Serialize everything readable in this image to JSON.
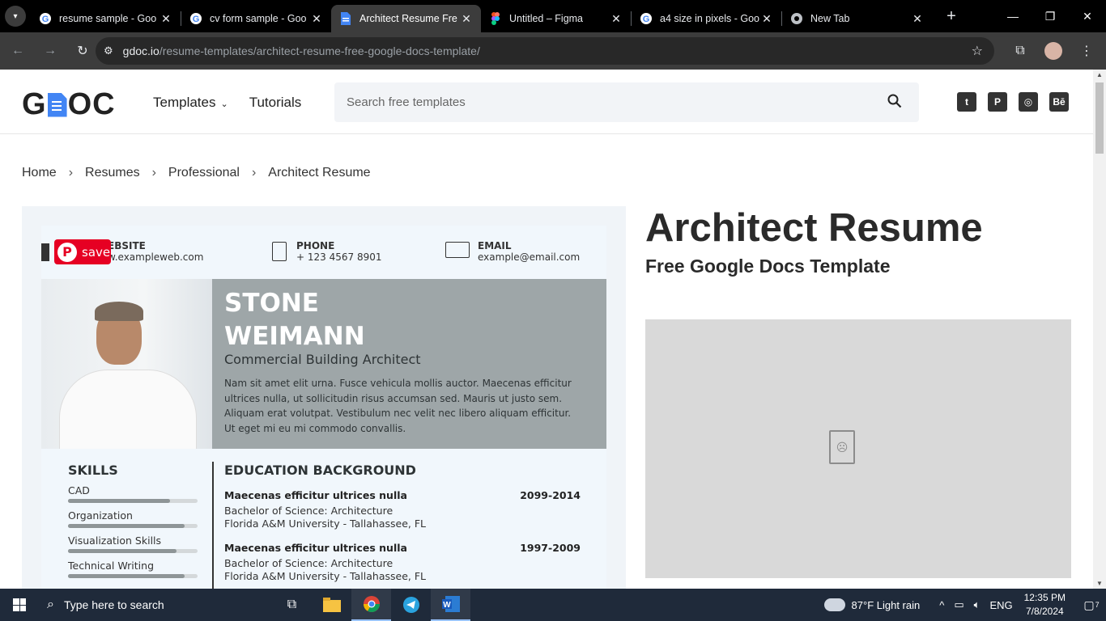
{
  "browser": {
    "tabs": [
      {
        "title": "resume sample - Goo",
        "favicon": "google-icon",
        "active": false
      },
      {
        "title": "cv form sample - Goo",
        "favicon": "google-icon",
        "active": false
      },
      {
        "title": "Architect Resume Fre",
        "favicon": "gdoc-icon",
        "active": true
      },
      {
        "title": "Untitled – Figma",
        "favicon": "figma-icon",
        "active": false
      },
      {
        "title": "a4 size in pixels - Goo",
        "favicon": "google-icon",
        "active": false
      },
      {
        "title": "New Tab",
        "favicon": "chrome-icon",
        "active": false
      }
    ],
    "url_domain": "gdoc.io",
    "url_path": "/resume-templates/architect-resume-free-google-docs-template/"
  },
  "site": {
    "logo_left": "G",
    "logo_right": "OC",
    "nav": [
      {
        "label": "Templates"
      },
      {
        "label": "Tutorials"
      }
    ],
    "search_placeholder": "Search free templates",
    "social": [
      "twitter-icon",
      "pinterest-icon",
      "dribbble-icon",
      "behance-icon"
    ],
    "behance_label": "Bē"
  },
  "breadcrumb": [
    "Home",
    "Resumes",
    "Professional",
    "Architect Resume"
  ],
  "resume": {
    "pin_label": "save",
    "website_label": "EBSITE",
    "website_value": "w.exampleweb.com",
    "phone_label": "PHONE",
    "phone_value": "+ 123 4567 8901",
    "email_label": "EMAIL",
    "email_value": "example@email.com",
    "first_name": "STONE",
    "last_name": "WEIMANN",
    "job_title": "Commercial Building Architect",
    "summary": "Nam sit amet elit urna. Fusce vehicula mollis auctor. Maecenas efficitur ultrices nulla, ut sollicitudin risus accumsan sed. Mauris ut justo sem. Aliquam erat volutpat. Vestibulum nec velit nec libero aliquam efficitur. Ut eget mi eu mi commodo convallis.",
    "skills_heading": "SKILLS",
    "skills": [
      {
        "name": "CAD",
        "level": 0.79
      },
      {
        "name": "Organization",
        "level": 0.9
      },
      {
        "name": "Visualization Skills",
        "level": 0.84
      },
      {
        "name": "Technical Writing",
        "level": 0.9
      }
    ],
    "education_heading": "EDUCATION BACKGROUND",
    "education": [
      {
        "title": "Maecenas efficitur ultrices nulla",
        "years": "2099-2014",
        "degree": "Bachelor of Science: Architecture",
        "school": "Florida A&M  University - Tallahassee, FL"
      },
      {
        "title": "Maecenas efficitur ultrices nulla",
        "years": "1997-2009",
        "degree": "Bachelor of Science: Architecture",
        "school": "Florida A&M  University - Tallahassee, FL"
      }
    ]
  },
  "page_heading": "Architect Resume",
  "page_subheading": "Free Google Docs Template",
  "taskbar": {
    "search_placeholder": "Type here to search",
    "weather": "87°F  Light rain",
    "language": "ENG",
    "time": "12:35 PM",
    "date": "7/8/2024",
    "notifications": "7"
  }
}
